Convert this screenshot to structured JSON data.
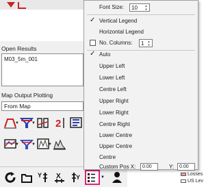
{
  "panel": {
    "open_results_label": "Open Results",
    "results_items": [
      "M03_5m_001"
    ],
    "map_output_label": "Map Output Plotting",
    "map_source_value": "From Map"
  },
  "legend_menu": {
    "font_size_label": "Font Size:",
    "font_size_value": "10",
    "vertical_legend": "Vertical Legend",
    "horizontal_legend": "Horizontal Legend",
    "no_columns_label": "No. Columns:",
    "no_columns_value": "1",
    "positions": [
      "Auto",
      "Upper Left",
      "Lower Left",
      "Centre Left",
      "Upper Right",
      "Lower Right",
      "Centre Right",
      "Lower Centre",
      "Upper Centre",
      "Centre"
    ],
    "custom_pos_label": "Custom Pos X:",
    "y_label": "Y:",
    "x_value": "0.00",
    "y_value": "0.00"
  },
  "right_legend": [
    "Losses",
    "US Lev"
  ]
}
